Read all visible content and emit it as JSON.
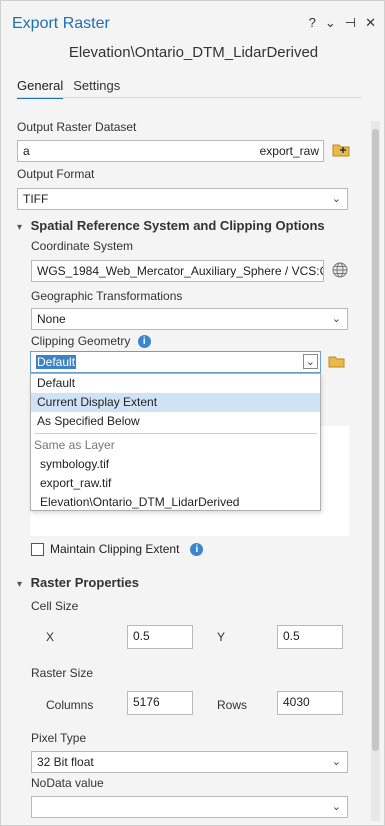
{
  "header": {
    "title": "Export Raster",
    "buttons": [
      "?",
      "⌄",
      "⊣",
      "✕"
    ],
    "subtitle": "Elevation\\Ontario_DTM_LidarDerived"
  },
  "tabs": [
    "General",
    "Settings"
  ],
  "output_raster": {
    "label": "Output Raster Dataset",
    "value_prefix": "a",
    "value_suffix": "export_raw"
  },
  "output_format": {
    "label": "Output Format",
    "value": "TIFF"
  },
  "spatial": {
    "title": "Spatial Reference System and Clipping Options",
    "coord_label": "Coordinate System",
    "coord_value": "WGS_1984_Web_Mercator_Auxiliary_Sphere / VCS:C",
    "geo_label": "Geographic Transformations",
    "geo_value": "None",
    "clip_label": "Clipping Geometry",
    "clip_value": "Default",
    "maintain_label": "Maintain Clipping Extent"
  },
  "clip_menu": {
    "items": [
      "Default",
      "Current Display Extent",
      "As Specified Below"
    ],
    "group_label": "Same as Layer",
    "layers": [
      "symbology.tif",
      "export_raw.tif",
      "Elevation\\Ontario_DTM_LidarDerived"
    ]
  },
  "raster": {
    "title": "Raster Properties",
    "cell_size_label": "Cell Size",
    "x_label": "X",
    "x_value": "0.5",
    "y_label": "Y",
    "y_value": "0.5",
    "raster_size_label": "Raster Size",
    "columns_label": "Columns",
    "columns_value": "5176",
    "rows_label": "Rows",
    "rows_value": "4030",
    "pixel_type_label": "Pixel Type",
    "pixel_type_value": "32 Bit float",
    "nodata_label": "NoData value",
    "nodata_value": ""
  },
  "colors": {
    "accent": "#1f6fb8",
    "highlight": "#cfe3f5",
    "info": "#3a86cf"
  }
}
